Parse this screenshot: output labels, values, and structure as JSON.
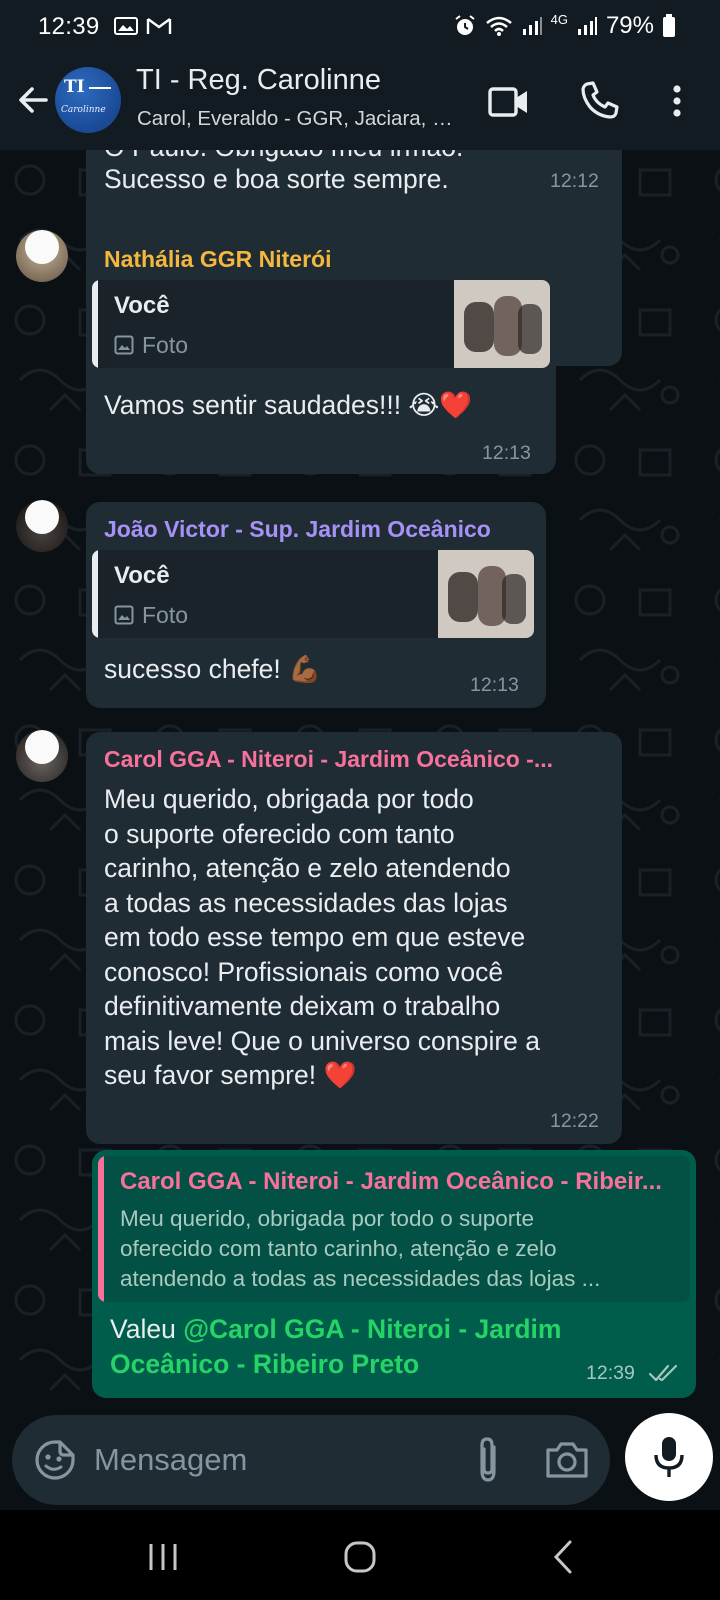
{
  "status_bar": {
    "time": "12:39",
    "network": "4G",
    "battery": "79%",
    "icons": [
      "photo-icon",
      "gmail-icon",
      "alarm-icon",
      "wifi-icon",
      "signal-icon",
      "signal-icon",
      "battery-icon"
    ]
  },
  "header": {
    "avatar_text": "TI",
    "avatar_subtext": "Carolinne",
    "title": "TI - Reg. Carolinne",
    "members": "Carol, Everaldo - GGR, Jaciara, João Victor",
    "icons": [
      "back-arrow-icon",
      "video-call-icon",
      "phone-icon",
      "more-vert-icon"
    ]
  },
  "messages": [
    {
      "type": "incoming",
      "partial_top_line": "O Paulo. Obrigado meu irmão.",
      "text": "Sucesso e boa sorte sempre.",
      "time": "12:12"
    },
    {
      "type": "incoming",
      "sender": "Nathália GGR Niterói",
      "sender_color": "#f5b83e",
      "quote": {
        "author": "Você",
        "media_type": "Foto"
      },
      "text": "Vamos sentir saudades!!! 😭❤️",
      "time": "12:13"
    },
    {
      "type": "incoming",
      "sender": "João Victor - Sup. Jardim Oceânico",
      "sender_color": "#a791f7",
      "quote": {
        "author": "Você",
        "media_type": "Foto"
      },
      "text": "sucesso chefe! 💪🏾",
      "time": "12:13"
    },
    {
      "type": "incoming",
      "sender": "Carol GGA - Niteroi - Jardim Oceânico -...",
      "sender_color": "#f7719b",
      "text": "Meu querido, obrigada por todo\no suporte oferecido com tanto\ncarinho, atenção e zelo atendendo\na todas as necessidades das lojas\nem todo esse tempo em que esteve\nconosco! Profissionais como você\ndefinitivamente deixam o trabalho\nmais leve! Que o universo conspire a\nseu favor sempre! ❤️",
      "time": "12:22"
    },
    {
      "type": "outgoing",
      "quote": {
        "author": "Carol GGA - Niteroi - Jardim Oceânico - Ribeir...",
        "text": "Meu querido, obrigada por todo o suporte\noferecido com tanto carinho, atenção e zelo\natendendo a todas as necessidades das lojas ..."
      },
      "text_prefix": "Valeu ",
      "mention_line1": "@Carol GGA - Niteroi - Jardim",
      "mention_line2": "Oceânico - Ribeiro Preto",
      "time": "12:39",
      "status": "read"
    }
  ],
  "input": {
    "placeholder": "Mensagem",
    "icons": [
      "emoji-sticker-icon",
      "attach-icon",
      "camera-icon",
      "mic-icon"
    ]
  },
  "nav_bar": {
    "icons": [
      "recents-icon",
      "home-icon",
      "back-icon"
    ]
  },
  "colors": {
    "header_bg": "#111b21",
    "chat_bg": "#0b1014",
    "incoming_bubble": "#1f2c34",
    "outgoing_bubble": "#005c4b",
    "mention": "#25d366",
    "quote_bar_outgoing": "#f7719b"
  }
}
